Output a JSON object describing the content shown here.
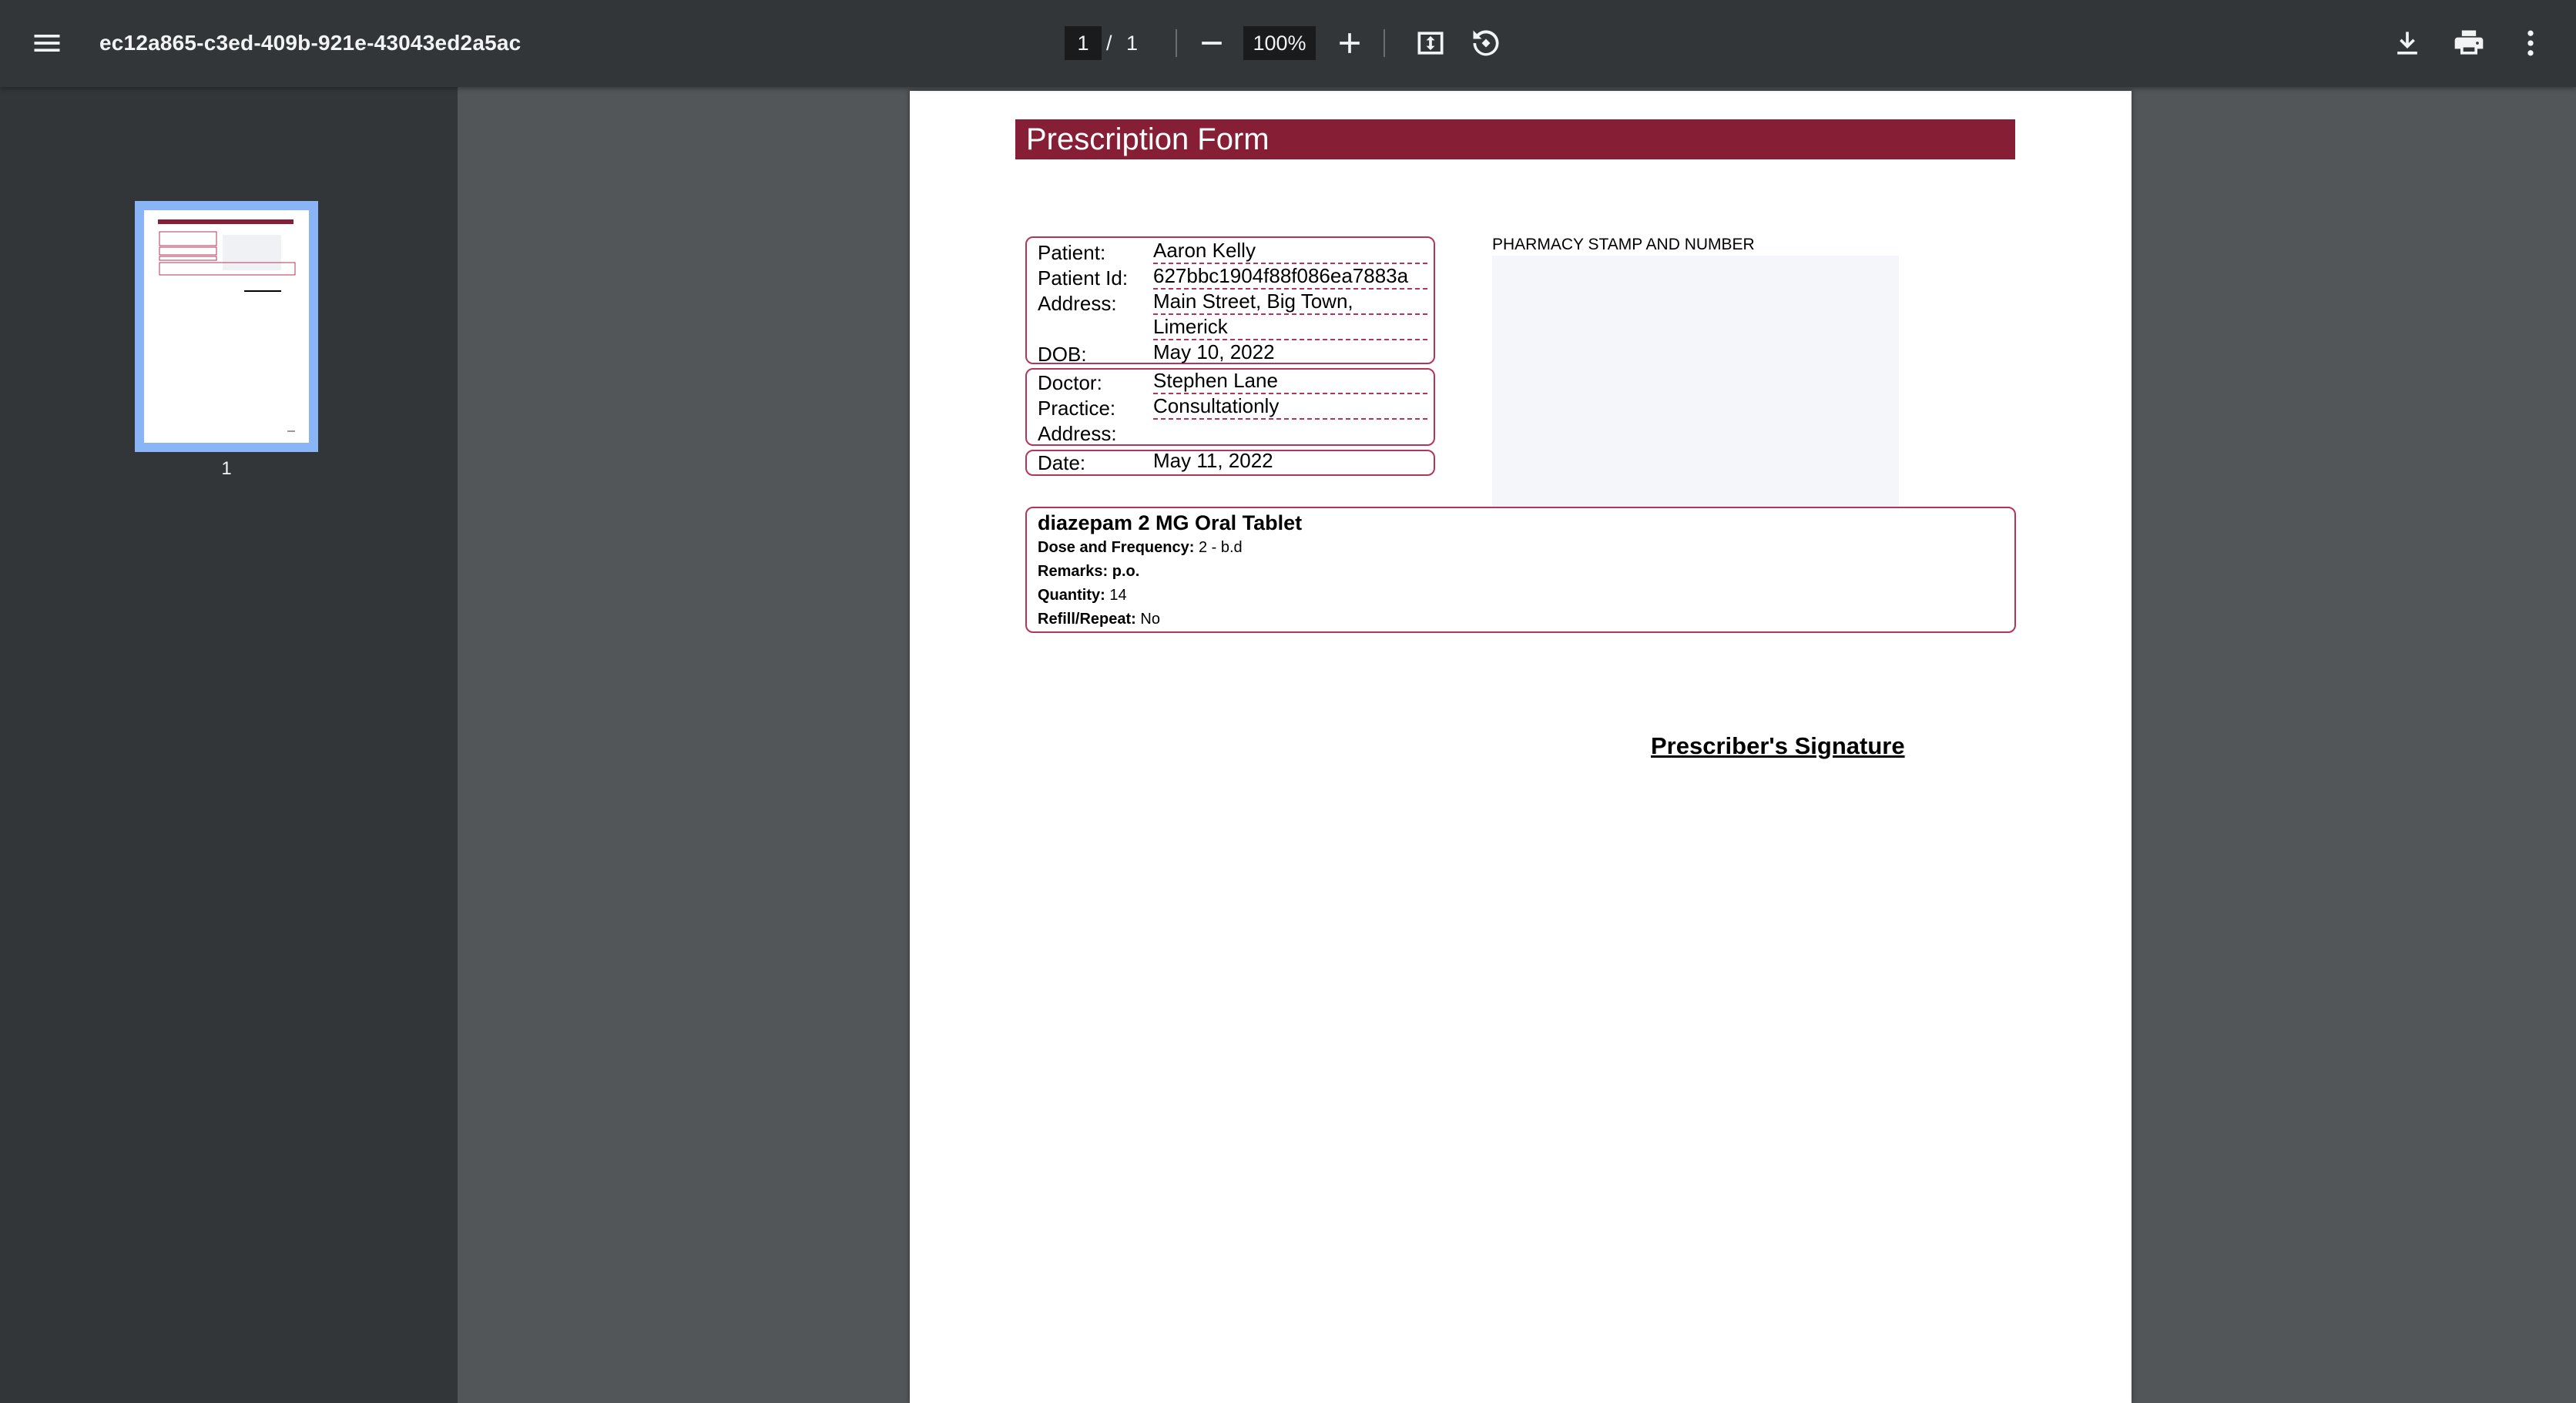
{
  "toolbar": {
    "title": "ec12a865-c3ed-409b-921e-43043ed2a5ac",
    "current_page": "1",
    "page_separator": "/",
    "total_pages": "1",
    "zoom": "100%",
    "icons": {
      "menu": "menu-icon",
      "zoom_out": "minus-icon",
      "zoom_in": "plus-icon",
      "fit": "fit-page-icon",
      "rotate": "rotate-icon",
      "download": "download-icon",
      "print": "print-icon",
      "more": "more-vert-icon"
    }
  },
  "sidebar": {
    "thumbnails": [
      {
        "page_label": "1",
        "selected": true
      }
    ]
  },
  "document": {
    "form_title": "Prescription Form",
    "patient": {
      "name_label": "Patient:",
      "name": "Aaron Kelly",
      "id_label": "Patient Id:",
      "id": "627bbc1904f88f086ea7883a",
      "address_label": "Address:",
      "address_line1": "Main Street, Big Town,",
      "address_line2": "Limerick",
      "dob_label": "DOB:",
      "dob": "May 10, 2022"
    },
    "doctor": {
      "doctor_label": "Doctor:",
      "doctor": "Stephen Lane",
      "practice_label": "Practice:",
      "practice": "Consultationly",
      "address_label": "Address:",
      "address": ""
    },
    "date": {
      "label": "Date:",
      "value": "May 11, 2022"
    },
    "pharmacy_stamp_label": "PHARMACY STAMP AND NUMBER",
    "medication": {
      "name": "diazepam 2 MG Oral Tablet",
      "dose_label": "Dose and Frequency:",
      "dose": "2 - b.d",
      "remarks_label": "Remarks:",
      "remarks": "p.o.",
      "quantity_label": "Quantity:",
      "quantity": "14",
      "refill_label": "Refill/Repeat:",
      "refill": "No"
    },
    "signature_label": "Prescriber's Signature"
  },
  "colors": {
    "toolbar_bg": "#323639",
    "viewer_bg": "#525659",
    "header_red": "#861f36",
    "border_red": "#b3365a",
    "thumb_selected": "#8ab4f8"
  }
}
